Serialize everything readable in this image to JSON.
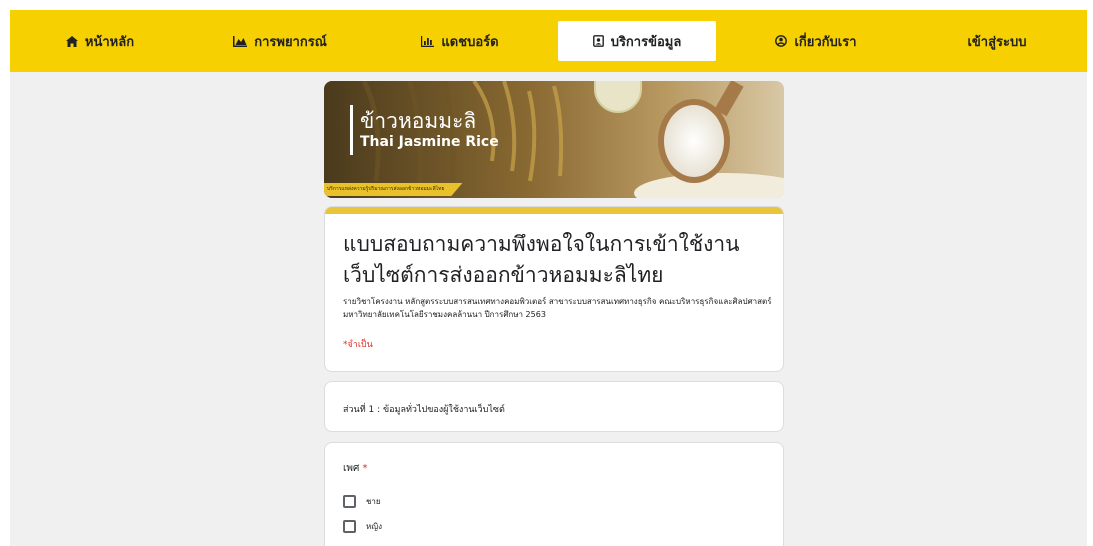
{
  "nav": {
    "items": [
      {
        "label": "หน้าหลัก",
        "icon": "home-icon"
      },
      {
        "label": "การพยากรณ์",
        "icon": "area-chart-icon"
      },
      {
        "label": "แดชบอร์ด",
        "icon": "bar-chart-icon"
      },
      {
        "label": "บริการข้อมูล",
        "icon": "contact-card-icon"
      },
      {
        "label": "เกี่ยวกับเรา",
        "icon": "user-circle-icon"
      },
      {
        "label": "เข้าสู่ระบบ"
      }
    ],
    "active_index": 3
  },
  "banner": {
    "title_th": "ข้าวหอมมะลิ",
    "title_en": "Thai Jasmine Rice",
    "tagline": "บริการแหล่งความรู้ปริมาณการส่งออกข้าวหอมมะลิไทย"
  },
  "form": {
    "title": "แบบสอบถามความพึงพอใจในการเข้าใช้งานเว็บไซต์การส่งออกข้าวหอมมะลิไทย",
    "description": "รายวิชาโครงงาน หลักสูตรระบบสารสนเทศทางคอมพิวเตอร์ สาขาระบบสารสนเทศทางธุรกิจ คณะบริหารธุรกิจและศิลปศาสตร์ มหาวิทยาลัยเทคโนโลยีราชมงคลล้านนา ปีการศึกษา 2563",
    "required_note": "*จำเป็น"
  },
  "section": {
    "label": "ส่วนที่ 1 : ข้อมูลทั่วไปของผู้ใช้งานเว็บไซต์"
  },
  "question": {
    "label": "เพศ",
    "required_mark": "*",
    "options": [
      "ชาย",
      "หญิง"
    ]
  },
  "colors": {
    "nav_bg": "#f6d000",
    "accent": "#e8c53a",
    "required": "#d93025"
  }
}
